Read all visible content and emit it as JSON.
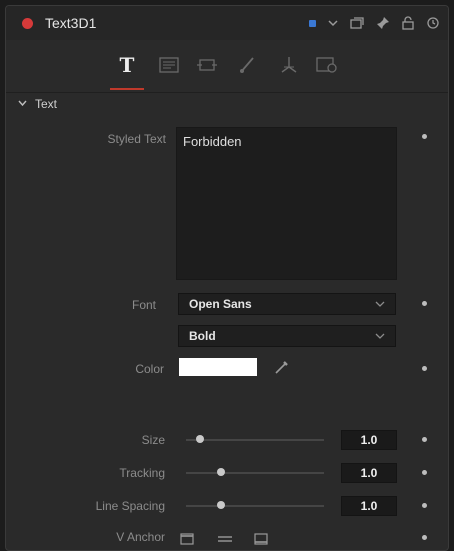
{
  "header": {
    "tool_name": "Text3D1",
    "accent_color": "#3a78d4"
  },
  "tabs": [
    {
      "id": "text",
      "label": "T",
      "active": true
    },
    {
      "id": "layout",
      "icon": "layout-icon"
    },
    {
      "id": "transform",
      "icon": "transform-icon"
    },
    {
      "id": "shading",
      "icon": "brush-icon"
    },
    {
      "id": "3d",
      "icon": "axis-icon"
    },
    {
      "id": "settings",
      "icon": "settings-icon"
    }
  ],
  "section": {
    "title": "Text",
    "expanded": true
  },
  "fields": {
    "styled_text_label": "Styled Text",
    "styled_text_value": "Forbidden",
    "font_label": "Font",
    "font_value": "Open Sans",
    "style_value": "Bold",
    "color_label": "Color",
    "color_value": "#ffffff",
    "size_label": "Size",
    "size_value": "1.0",
    "tracking_label": "Tracking",
    "tracking_value": "1.0",
    "line_spacing_label": "Line Spacing",
    "line_spacing_value": "1.0",
    "v_anchor_label": "V Anchor"
  },
  "sliders": {
    "size_position": 0.1,
    "tracking_position": 0.25,
    "line_spacing_position": 0.25
  }
}
